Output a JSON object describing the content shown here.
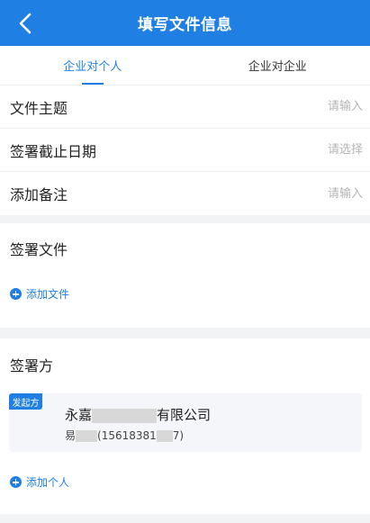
{
  "header": {
    "title": "填写文件信息",
    "back_icon": "chevron-left-icon"
  },
  "tabs": [
    {
      "label": "企业对个人",
      "active": true
    },
    {
      "label": "企业对企业",
      "active": false
    }
  ],
  "form": {
    "subject": {
      "label": "文件主题",
      "placeholder": "请输入"
    },
    "deadline": {
      "label": "签署截止日期",
      "placeholder": "请选择"
    },
    "remark": {
      "label": "添加备注",
      "placeholder": "请输入"
    }
  },
  "files": {
    "title": "签署文件",
    "add_label": "添加文件"
  },
  "signers": {
    "title": "签署方",
    "party": {
      "badge": "发起方",
      "name_prefix": "永嘉",
      "name_suffix": "有限公司",
      "contact_prefix": "易",
      "phone_prefix": "(15618381",
      "phone_suffix": "7)"
    },
    "add_label": "添加个人"
  },
  "colors": {
    "accent": "#1f7fe3",
    "background": "#f2f3f5"
  }
}
